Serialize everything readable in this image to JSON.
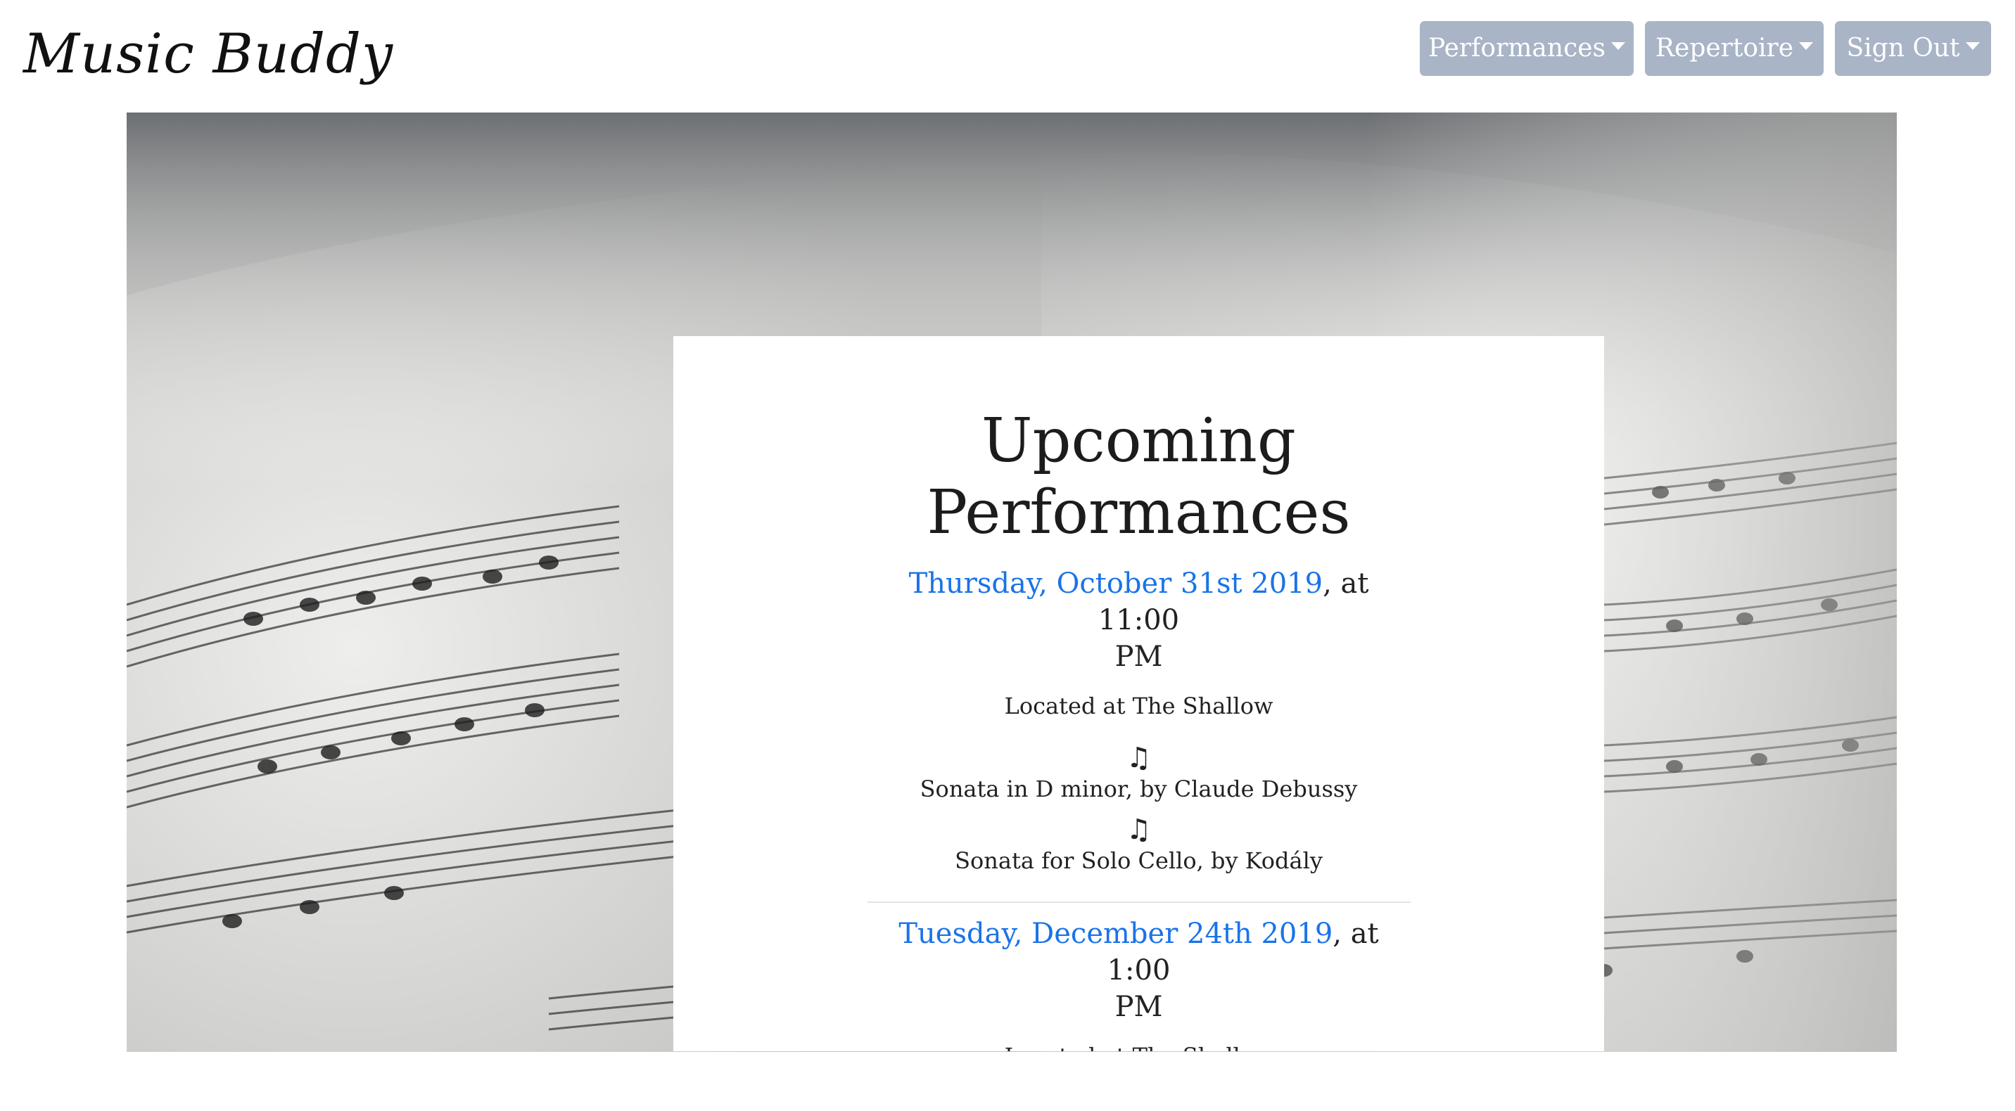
{
  "brand": "Music Buddy",
  "nav": {
    "performances": "Performances",
    "repertoire": "Repertoire",
    "sign_out": "Sign Out"
  },
  "card": {
    "title_line1": "Upcoming",
    "title_line2": "Performances",
    "performances": [
      {
        "date": "Thursday, October 31st 2019",
        "time_line1": ", at 11:00",
        "time_line2": "PM",
        "location": "Located at The Shallow",
        "pieces": [
          {
            "note": "♫",
            "text": "Sonata in D minor, by Claude Debussy"
          },
          {
            "note": "♫",
            "text": "Sonata for Solo Cello, by Kodály"
          }
        ]
      },
      {
        "date": "Tuesday, December 24th 2019",
        "time_line1": ", at 1:00",
        "time_line2": "PM",
        "location": "Located at The Shallow"
      }
    ]
  },
  "colors": {
    "nav_button": "#a9b4c6",
    "link": "#1a73e8"
  },
  "icons": {
    "dropdown": "caret-down-icon",
    "piece": "music-note-icon"
  }
}
